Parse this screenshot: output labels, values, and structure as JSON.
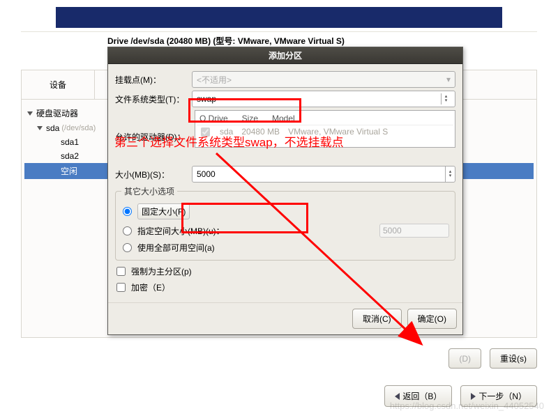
{
  "drive_label": "Drive /dev/sda (20480 MB) (型号: VMware, VMware Virtual S)",
  "tree_header": "设备",
  "tree": {
    "root": "硬盘驱动器",
    "disk": "sda",
    "disk_path": "(/dev/sda)",
    "p1": "sda1",
    "p2": "sda2",
    "free": "空闲"
  },
  "dialog": {
    "title": "添加分区",
    "mount_label": "挂载点(M)：",
    "mount_value": "<不适用>",
    "fs_label": "文件系统类型(T)：",
    "fs_value": "swap",
    "drives_label": "允许的驱动器(D)：",
    "drives_head_drive": "O  Drive",
    "drives_head_size": "Size",
    "drives_head_model": "Model",
    "drives_row_name": "sda",
    "drives_row_size": "20480 MB",
    "drives_row_model": "VMware, VMware Virtual S",
    "size_label": "大小(MB)(S)：",
    "size_value": "5000",
    "fieldset": "其它大小选项",
    "opt_fixed": "固定大小(F)",
    "opt_upto": "指定空间大小(MB)(u)：",
    "opt_upto_val": "5000",
    "opt_fill": "使用全部可用空间(a)",
    "chk_primary": "强制为主分区(p)",
    "chk_encrypt": "加密（E）",
    "btn_cancel": "取消(C)",
    "btn_ok": "确定(O)"
  },
  "annotation": "第三个选择文件系统类型swap，不选挂载点",
  "bottom": {
    "d": "(D)",
    "reset": "重设(s)"
  },
  "nav": {
    "back": "返回（B）",
    "next": "下一步（N）"
  },
  "watermark": "https://blog.csdn.net/weixin_44052540"
}
